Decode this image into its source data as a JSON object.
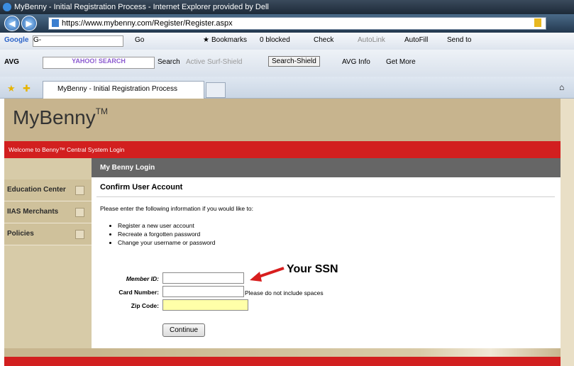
{
  "window": {
    "title": "MyBenny - Initial Registration Process - Internet Explorer provided by Dell"
  },
  "address_bar": {
    "url": "https://www.mybenny.com/Register/Register.aspx"
  },
  "google_toolbar": {
    "brand": "Google",
    "search_prefix": "G-",
    "go": "Go",
    "bookmarks": "Bookmarks",
    "blocked": "0 blocked",
    "check": "Check",
    "autolink": "AutoLink",
    "autofill": "AutoFill",
    "send_to": "Send to"
  },
  "avg_toolbar": {
    "brand": "AVG",
    "search_box": "YAHOO! SEARCH",
    "search": "Search",
    "active_surf_shield": "Active Surf-Shield",
    "search_shield": "Search-Shield",
    "avg_info": "AVG Info",
    "get_more": "Get More"
  },
  "tab": {
    "title": "MyBenny - Initial Registration Process"
  },
  "site": {
    "logo": "MyBenny",
    "logo_tm": "TM",
    "welcome": "Welcome to Benny™ Central System Login"
  },
  "sidebar": {
    "items": [
      {
        "label": "Education Center"
      },
      {
        "label": "IIAS Merchants"
      },
      {
        "label": "Policies"
      }
    ]
  },
  "login": {
    "header": "My Benny Login",
    "section_title": "Confirm User Account",
    "intro": "Please enter the following information if you would like to:",
    "options": [
      "Register a new user account",
      "Recreate a forgotten password",
      "Change your username or password"
    ],
    "fields": {
      "member_id_label": "Member ID:",
      "card_number_label": "Card Number:",
      "card_number_note": "Please do not include spaces",
      "zip_label": "Zip Code:"
    },
    "continue_label": "Continue"
  },
  "annotation": {
    "text": "Your SSN",
    "color": "#d81e1e"
  }
}
